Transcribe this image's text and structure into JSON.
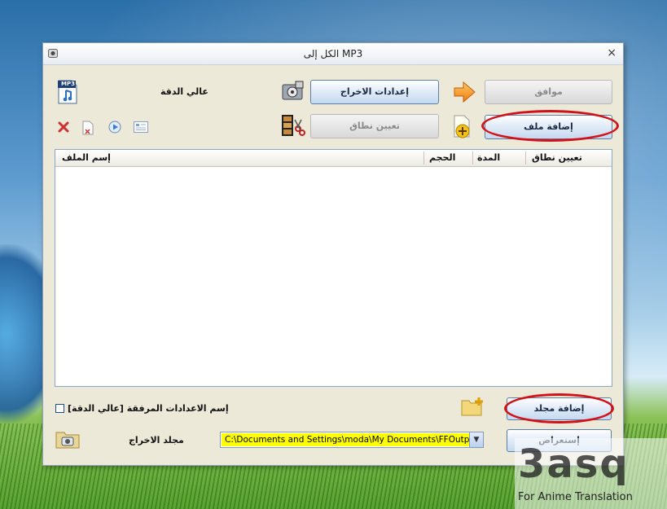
{
  "window": {
    "title": "الكل إلى MP3",
    "close_glyph": "×"
  },
  "top": {
    "quality_label": "عالي الدقة",
    "output_settings_button": "إعدادات الاخراج",
    "ok_button": "موافق",
    "set_range_button": "تعيين نطاق",
    "add_file_button": "إضافة ملف",
    "mp3_badge": "MP3"
  },
  "toolbar_icons": [
    "delete-icon",
    "remove-file-icon",
    "play-icon",
    "info-icon"
  ],
  "file_list": {
    "columns": [
      "إسم الملف",
      "الحجم",
      "المدة",
      "تعيين نطاق"
    ],
    "rows": []
  },
  "bottom": {
    "checkbox_label": "[إسم الاعدادات المرفقة [عالي الدقة",
    "checkbox_checked": false,
    "add_folder_button": "إضافة مجلد",
    "output_folder_label": "مجلد الاخراج",
    "output_path": "C:\\Documents and Settings\\moda\\My Documents\\FFOutput",
    "browse_button": "إستعراض"
  },
  "watermark": {
    "brand": "3asq",
    "tagline": "For Anime Translation"
  },
  "colors": {
    "annotation_ring": "#d2121a",
    "path_highlight": "#ffff00",
    "button_border": "#5c7fa6"
  }
}
